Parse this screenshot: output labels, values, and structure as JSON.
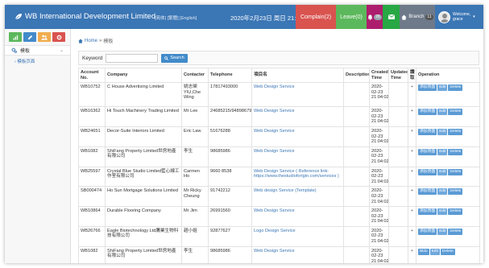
{
  "header": {
    "title": "WB International Development Limited",
    "lang": "[简体] [繁體] [English]",
    "datetime": "2020年2月23日 周日 21:13:58",
    "complain": "Complain(2)",
    "leave": "Leave(0)",
    "bell_badge": "26",
    "branch": "Branch",
    "branch_badge": "11",
    "welcome": "Welcome,",
    "user_name": "grace"
  },
  "sidebar": {
    "menu_head": "模板",
    "menu_sub": "模板页面"
  },
  "breadcrumb": {
    "home": "Home",
    "current": "模板"
  },
  "search": {
    "label": "Keyword",
    "value": "",
    "button": "Search"
  },
  "table": {
    "headers": [
      "Account No.",
      "Company",
      "Contacter",
      "Telephone",
      "項目名",
      "Description",
      "Created Time",
      "Updated Time",
      "讀 取",
      "Operation"
    ],
    "rows": [
      {
        "account": "WB10752",
        "company": "C House Advertising Limited",
        "contacter": "姚志榮 YIU,Che Wing",
        "telephone": "17817493000",
        "project": "Web Design Service",
        "description": "",
        "created": "2020-02-23 21:04:02",
        "updated": "",
        "read": "+",
        "ops": [
          "添加頁面",
          "Edit",
          "Delete"
        ]
      },
      {
        "account": "WB16362",
        "company": "Hi Touch Machinery Trading Limited",
        "contacter": "Mr Lee",
        "telephone": "24685215/94898679",
        "project": "Web Design Service",
        "description": "",
        "created": "2020-02-23 21:04:02",
        "updated": "",
        "read": "+",
        "ops": [
          "添加頁面",
          "Edit",
          "Delete"
        ]
      },
      {
        "account": "WB24651",
        "company": "Decor-Suite Interiors Limited",
        "contacter": "Eric Law",
        "telephone": "51676288",
        "project": "Web Design Service",
        "description": "",
        "created": "2020-02-23 21:04:02",
        "updated": "",
        "read": "+",
        "ops": [
          "添加頁面",
          "Edit",
          "Delete"
        ]
      },
      {
        "account": "WB1082",
        "company": "ShiFang Property Limited世房地產有限公司",
        "contacter": "李生",
        "telephone": "98685986",
        "project": "Web Design Service",
        "description": "",
        "created": "2020-02-23 21:04:02",
        "updated": "",
        "read": "+",
        "ops": [
          "添加頁面",
          "Edit",
          "Delete"
        ]
      },
      {
        "account": "WB25597",
        "company": "Crystal Blue Studio Limited藍心線工作室有限公司",
        "contacter": "Carmen Ho",
        "telephone": "9660 8538",
        "project": "Web Design Service ( Reference link: https://www.thestudioforigin.com/services )",
        "description": "",
        "created": "2020-02-23 21:04:02",
        "updated": "",
        "read": "+",
        "ops": [
          "添加頁面",
          "Edit",
          "Delete"
        ]
      },
      {
        "account": "SB000474",
        "company": "Ho Sun Mortgage Solutions Limited",
        "contacter": "Mr Ricky Cheung",
        "telephone": "91742212",
        "project": "Web design Service (Template)",
        "description": "",
        "created": "2020-02-23 21:04:02",
        "updated": "",
        "read": "+",
        "ops": [
          "添加頁面",
          "Edit",
          "Delete"
        ]
      },
      {
        "account": "WB10864",
        "company": "Durable Flooring Company",
        "contacter": "Mr Jim",
        "telephone": "26991560",
        "project": "Web Design Service",
        "description": "",
        "created": "2020-02-23 21:04:02",
        "updated": "",
        "read": "+",
        "ops": [
          "添加頁面",
          "Edit",
          "Delete"
        ]
      },
      {
        "account": "WB26766",
        "company": "Eagle Biotechnology Ltd鷹業生物科技有限公司",
        "contacter": "趙小姐",
        "telephone": "92877627",
        "project": "Logo Design Service",
        "description": "",
        "created": "2020-02-23 21:04:02",
        "updated": "",
        "read": "+",
        "ops": [
          "添加頁面",
          "Edit",
          "Delete"
        ]
      },
      {
        "account": "WB1082",
        "company": "ShiFang Property Limited世房地產有限公司",
        "contacter": "李生",
        "telephone": "98685986",
        "project": "Web Design Service",
        "description": "",
        "created": "2020-02-23 21:04:02",
        "updated": "",
        "read": "+",
        "ops": [
          "Bldo",
          "Edit",
          "Delete"
        ]
      }
    ]
  }
}
